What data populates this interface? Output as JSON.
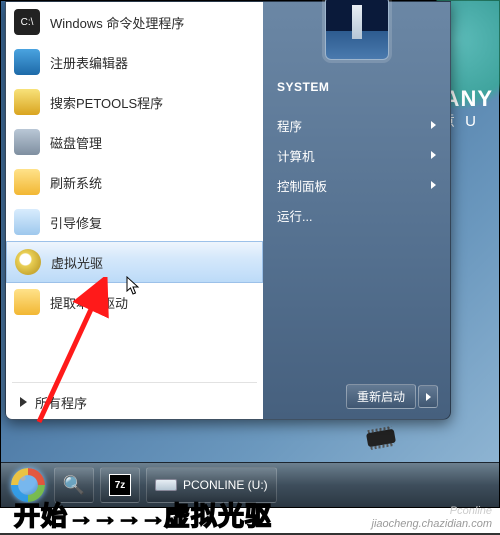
{
  "brand": {
    "en": "TIANY",
    "cn": "天意 U"
  },
  "startmenu": {
    "user": "SYSTEM",
    "left_items": [
      {
        "label": "Windows 命令处理程序",
        "icon": "ico-cmd"
      },
      {
        "label": "注册表编辑器",
        "icon": "ico-reg"
      },
      {
        "label": "搜索PETOOLS程序",
        "icon": "ico-search"
      },
      {
        "label": "磁盘管理",
        "icon": "ico-disk"
      },
      {
        "label": "刷新系统",
        "icon": "ico-refresh"
      },
      {
        "label": "引导修复",
        "icon": "ico-boot"
      },
      {
        "label": "虚拟光驱",
        "icon": "ico-vcd",
        "selected": true
      },
      {
        "label": "提取本机驱动",
        "icon": "ico-drv"
      }
    ],
    "all_programs": "所有程序",
    "right_items": [
      {
        "label": "程序",
        "arrow": true
      },
      {
        "label": "计算机",
        "arrow": true
      },
      {
        "label": "控制面板",
        "arrow": true
      },
      {
        "label": "运行...",
        "arrow": false
      }
    ],
    "restart": "重新启动"
  },
  "taskbar": {
    "buttons": [
      {
        "name": "magnifier",
        "icon": "ico-mag",
        "glyph": "🔍"
      },
      {
        "name": "7zip",
        "icon": "ico-7z",
        "glyph": "7z"
      },
      {
        "name": "drive",
        "icon": "ico-hdd",
        "label": "PCONLINE (U:)"
      }
    ]
  },
  "instruction": {
    "a": "开始",
    "arrows": "→→→→",
    "b": "虚拟光驱"
  },
  "watermark": {
    "top": "Pconline",
    "bottom": "jiaocheng.chazidian.com"
  }
}
